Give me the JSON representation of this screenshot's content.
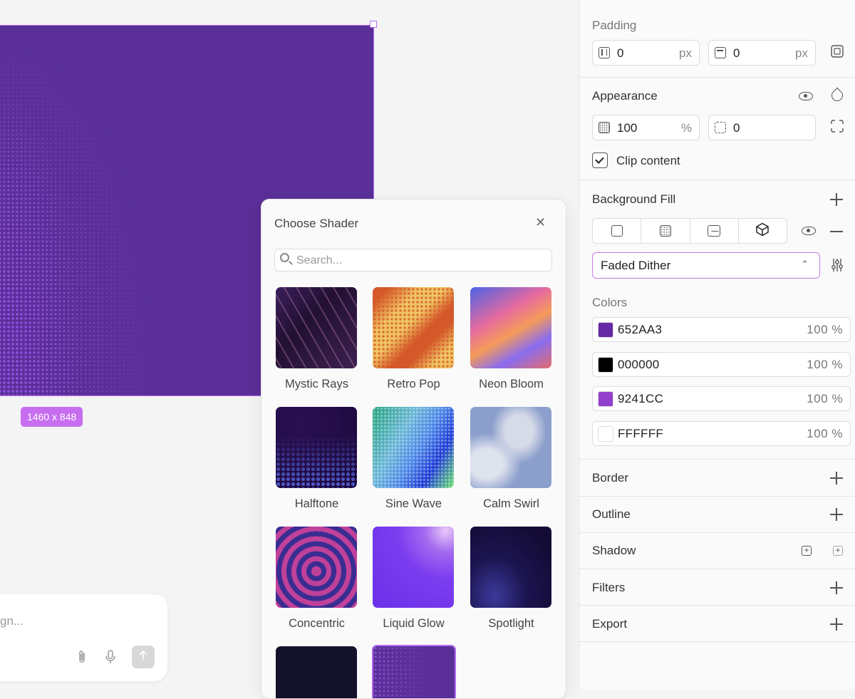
{
  "canvas": {
    "size_badge": "1460 x 848",
    "frame_color": "#5a2f98",
    "chat": {
      "placeholder": "gn...",
      "attach_icon": "paperclip-icon",
      "mic_icon": "microphone-icon",
      "send_icon": "arrow-up-icon"
    }
  },
  "shader_picker": {
    "title": "Choose Shader",
    "search_placeholder": "Search...",
    "shaders": [
      {
        "name": "Mystic Rays"
      },
      {
        "name": "Retro Pop"
      },
      {
        "name": "Neon Bloom"
      },
      {
        "name": "Halftone"
      },
      {
        "name": "Sine Wave"
      },
      {
        "name": "Calm Swirl"
      },
      {
        "name": "Concentric"
      },
      {
        "name": "Liquid Glow"
      },
      {
        "name": "Spotlight"
      }
    ]
  },
  "panel": {
    "padding": {
      "title": "Padding",
      "horizontal": "0",
      "vertical": "0",
      "unit": "px"
    },
    "appearance": {
      "title": "Appearance",
      "opacity": "100",
      "opacity_unit": "%",
      "radius": "0",
      "clip_content": "Clip content"
    },
    "background_fill": {
      "title": "Background Fill",
      "selected_shader": "Faded Dither",
      "colors_title": "Colors",
      "colors": [
        {
          "hex": "652AA3",
          "opacity": "100 %",
          "swatch": "#652AA3"
        },
        {
          "hex": "000000",
          "opacity": "100 %",
          "swatch": "#000000"
        },
        {
          "hex": "9241CC",
          "opacity": "100 %",
          "swatch": "#9241CC"
        },
        {
          "hex": "FFFFFF",
          "opacity": "100 %",
          "swatch": "#FFFFFF"
        }
      ]
    },
    "sections": {
      "border": "Border",
      "outline": "Outline",
      "shadow": "Shadow",
      "filters": "Filters",
      "export": "Export"
    }
  }
}
